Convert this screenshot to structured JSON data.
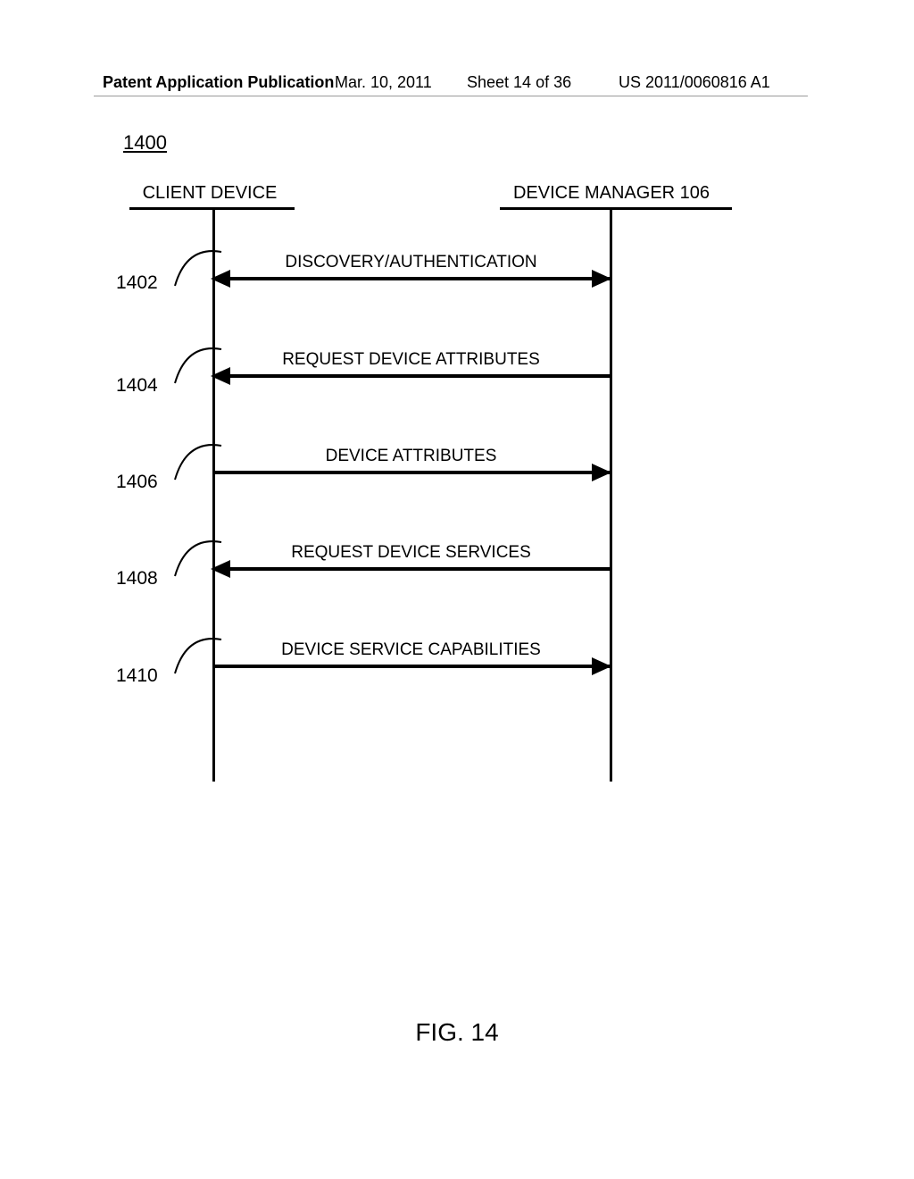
{
  "header": {
    "publication_label": "Patent Application Publication",
    "date": "Mar. 10, 2011",
    "sheet": "Sheet 14 of 36",
    "docnum": "US 2011/0060816 A1"
  },
  "figure_number": "1400",
  "participants": {
    "left": "CLIENT DEVICE",
    "right": "DEVICE MANAGER 106"
  },
  "messages": [
    {
      "ref": "1402",
      "label": "DISCOVERY/AUTHENTICATION",
      "dir": "both"
    },
    {
      "ref": "1404",
      "label": "REQUEST DEVICE ATTRIBUTES",
      "dir": "left"
    },
    {
      "ref": "1406",
      "label": "DEVICE ATTRIBUTES",
      "dir": "right"
    },
    {
      "ref": "1408",
      "label": "REQUEST DEVICE SERVICES",
      "dir": "left"
    },
    {
      "ref": "1410",
      "label": "DEVICE SERVICE CAPABILITIES",
      "dir": "right"
    }
  ],
  "caption": "FIG. 14"
}
